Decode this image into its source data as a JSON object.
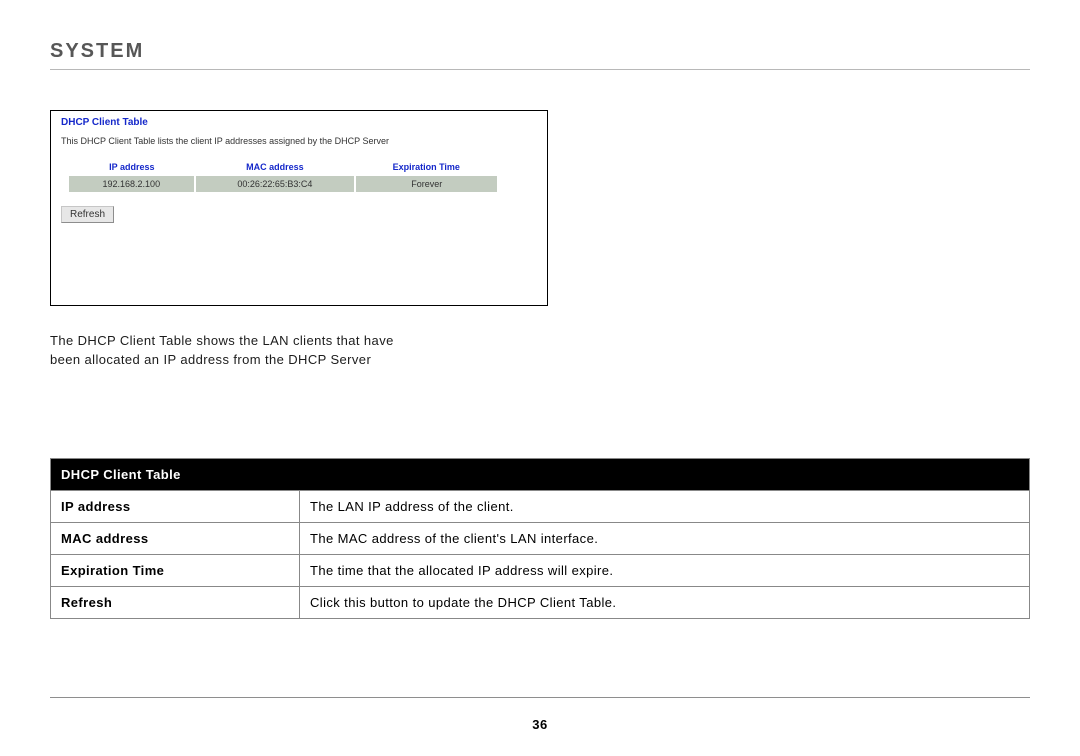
{
  "page_title": "SYSTEM",
  "page_number": "36",
  "screenshot": {
    "title": "DHCP Client Table",
    "description": "This DHCP Client Table lists the client IP addresses assigned by the DHCP Server",
    "columns": {
      "c0": "IP address",
      "c1": "MAC address",
      "c2": "Expiration Time"
    },
    "row": {
      "ip": "192.168.2.100",
      "mac": "00:26:22:65:B3:C4",
      "exp": "Forever"
    },
    "refresh_label": "Refresh"
  },
  "caption_line1": "The DHCP Client Table shows the LAN clients that have",
  "caption_line2": "been allocated an IP address from the DHCP Server",
  "spec_table": {
    "header": "DHCP Client Table",
    "rows": {
      "r0": {
        "name": "IP address",
        "desc": "The LAN IP address of the client."
      },
      "r1": {
        "name": "MAC address",
        "desc": "The MAC address of the client's LAN interface."
      },
      "r2": {
        "name": "Expiration Time",
        "desc": "The time that the allocated IP address will expire."
      },
      "r3": {
        "name": "Refresh",
        "desc": "Click this button to update the DHCP Client Table."
      }
    }
  }
}
